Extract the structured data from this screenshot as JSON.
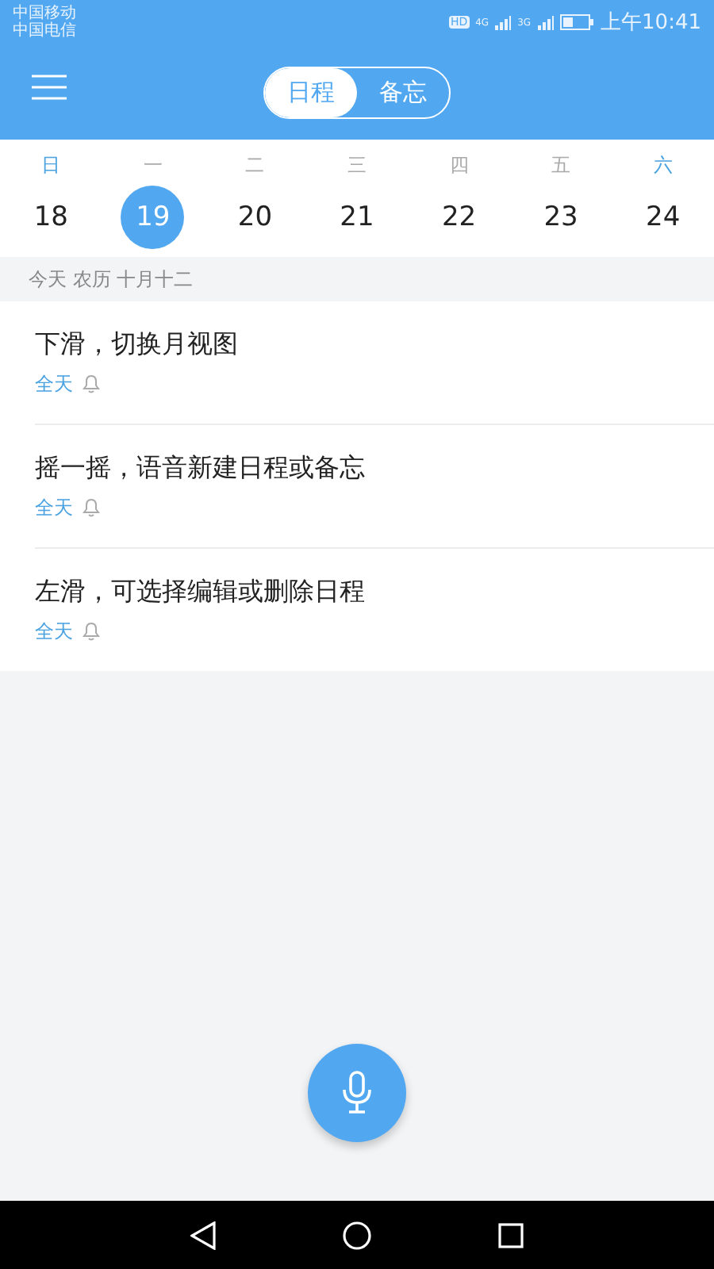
{
  "status_bar": {
    "carriers": [
      "中国移动",
      "中国电信"
    ],
    "hd": "HD",
    "net1": "4G",
    "net2": "3G",
    "time": "上午10:41"
  },
  "header": {
    "tabs": [
      {
        "label": "日程",
        "selected": true
      },
      {
        "label": "备忘",
        "selected": false
      }
    ]
  },
  "week": [
    {
      "weekday": "日",
      "date": "18",
      "kind": "weekend",
      "selected": false
    },
    {
      "weekday": "一",
      "date": "19",
      "kind": "weekday",
      "selected": true
    },
    {
      "weekday": "二",
      "date": "20",
      "kind": "weekday",
      "selected": false
    },
    {
      "weekday": "三",
      "date": "21",
      "kind": "weekday",
      "selected": false
    },
    {
      "weekday": "四",
      "date": "22",
      "kind": "weekday",
      "selected": false
    },
    {
      "weekday": "五",
      "date": "23",
      "kind": "weekday",
      "selected": false
    },
    {
      "weekday": "六",
      "date": "24",
      "kind": "weekend",
      "selected": false
    }
  ],
  "lunar": "今天 农历 十月十二",
  "events": [
    {
      "title": "下滑，切换月视图",
      "time": "全天"
    },
    {
      "title": "摇一摇，语音新建日程或备忘",
      "time": "全天"
    },
    {
      "title": "左滑，可选择编辑或删除日程",
      "time": "全天"
    }
  ]
}
